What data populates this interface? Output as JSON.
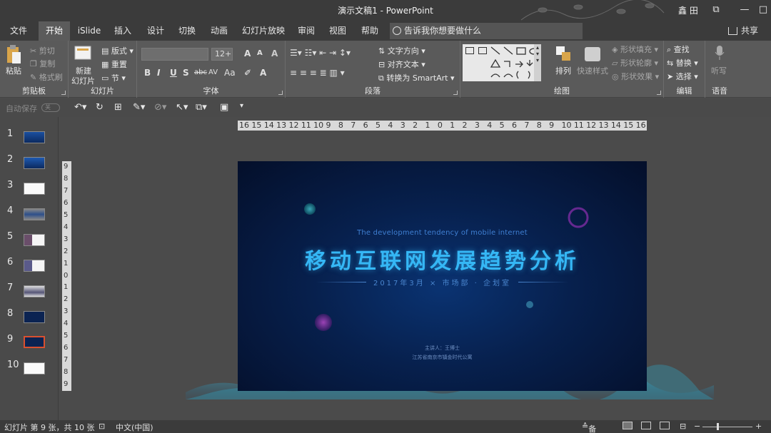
{
  "window": {
    "title": "演示文稿1  -  PowerPoint",
    "user": "鑫 田",
    "controls": {
      "restore": "⧉",
      "minimize": "—",
      "maximize": "□",
      "close": "✕"
    }
  },
  "tabs": [
    {
      "label": "文件"
    },
    {
      "label": "开始"
    },
    {
      "label": "iSlide"
    },
    {
      "label": "插入"
    },
    {
      "label": "设计"
    },
    {
      "label": "切换"
    },
    {
      "label": "动画"
    },
    {
      "label": "幻灯片放映"
    },
    {
      "label": "审阅"
    },
    {
      "label": "视图"
    },
    {
      "label": "帮助"
    }
  ],
  "active_tab": "开始",
  "tell_me": "告诉我你想要做什么",
  "share": "共享",
  "ribbon": {
    "clipboard": {
      "paste": "粘贴",
      "cut": "剪切",
      "copy": "复制",
      "format_painter": "格式刷",
      "label": "剪贴板"
    },
    "slides": {
      "new_slide_1": "新建",
      "new_slide_2": "幻灯片",
      "layout": "版式",
      "reset": "重置",
      "section": "节",
      "label": "幻灯片"
    },
    "font": {
      "font_size": "12+",
      "grow": "A",
      "shrink": "A",
      "bold": "B",
      "italic": "I",
      "underline": "U",
      "shadow": "S",
      "strike": "abc",
      "spacing": "AV",
      "case": "Aa",
      "clear": "A",
      "label": "字体"
    },
    "paragraph": {
      "text_direction": "文字方向",
      "align_text": "对齐文本",
      "smartart": "转换为 SmartArt",
      "label": "段落"
    },
    "drawing": {
      "arrange": "排列",
      "quick_styles": "快速样式",
      "shape_fill": "形状填充",
      "shape_outline": "形状轮廓",
      "shape_effects": "形状效果",
      "label": "绘图"
    },
    "editing": {
      "find": "查找",
      "replace": "替换",
      "select": "选择",
      "label": "编辑"
    },
    "voice": {
      "dictate": "听写",
      "label": "语音"
    }
  },
  "qat": {
    "autosave": "自动保存",
    "toggle": "关"
  },
  "slides": [
    {
      "num": "1"
    },
    {
      "num": "2"
    },
    {
      "num": "3"
    },
    {
      "num": "4"
    },
    {
      "num": "5"
    },
    {
      "num": "6"
    },
    {
      "num": "7"
    },
    {
      "num": "8"
    },
    {
      "num": "9"
    },
    {
      "num": "10"
    }
  ],
  "selected_slide": 9,
  "ruler": {
    "h": [
      "16",
      "15",
      "14",
      "13",
      "12",
      "11",
      "10",
      "9",
      "8",
      "7",
      "6",
      "5",
      "4",
      "3",
      "2",
      "1",
      "0",
      "1",
      "2",
      "3",
      "4",
      "5",
      "6",
      "7",
      "8",
      "9",
      "10",
      "11",
      "12",
      "13",
      "14",
      "15",
      "16"
    ],
    "v": [
      "9",
      "8",
      "7",
      "6",
      "5",
      "4",
      "3",
      "2",
      "1",
      "0",
      "1",
      "2",
      "3",
      "4",
      "5",
      "6",
      "7",
      "8",
      "9"
    ]
  },
  "slide_content": {
    "subtitle_en": "The development tendency of mobile internet",
    "title": "移动互联网发展趋势分析",
    "dateline": "2017年3月 × 市场部 · 企划室",
    "presenter": "主讲人：王博士",
    "company": "江苏省南京市镇金时代公寓"
  },
  "status": {
    "slide_info": "幻灯片 第 9 张，共 10 张",
    "language": "中文(中国)",
    "notes": "备注"
  },
  "colors": {
    "accent": "#d9502f",
    "title": "#35b7f5",
    "slide_bg": "#07204d"
  }
}
